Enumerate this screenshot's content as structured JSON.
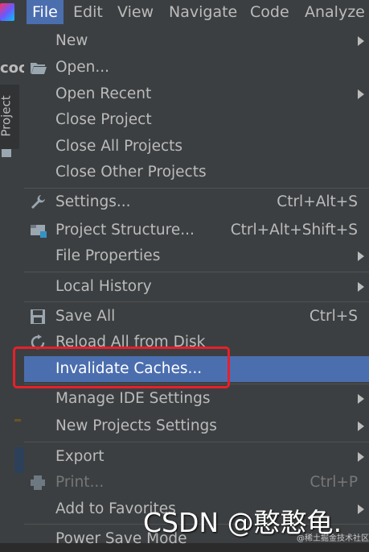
{
  "menubar": {
    "items": [
      {
        "label": "File",
        "active": true
      },
      {
        "label": "Edit"
      },
      {
        "label": "View"
      },
      {
        "label": "Navigate"
      },
      {
        "label": "Code"
      },
      {
        "label": "Analyze"
      }
    ]
  },
  "sidebar": {
    "tab_label": "Project",
    "toolbar_text": "coc"
  },
  "menu": {
    "items": [
      {
        "label": "New",
        "submenu": true
      },
      {
        "label": "Open...",
        "icon": "folder-open-icon"
      },
      {
        "label": "Open Recent",
        "submenu": true
      },
      {
        "label": "Close Project"
      },
      {
        "label": "Close All Projects"
      },
      {
        "label": "Close Other Projects"
      },
      {
        "label": "Settings...",
        "shortcut": "Ctrl+Alt+S",
        "icon": "wrench-icon"
      },
      {
        "label": "Project Structure...",
        "shortcut": "Ctrl+Alt+Shift+S",
        "icon": "project-structure-icon"
      },
      {
        "label": "File Properties",
        "submenu": true
      },
      {
        "label": "Local History",
        "submenu": true
      },
      {
        "label": "Save All",
        "shortcut": "Ctrl+S",
        "icon": "save-icon"
      },
      {
        "label": "Reload All from Disk",
        "icon": "reload-icon"
      },
      {
        "label": "Invalidate Caches...",
        "selected": true
      },
      {
        "label": "Manage IDE Settings",
        "submenu": true
      },
      {
        "label": "New Projects Settings",
        "submenu": true
      },
      {
        "label": "Export",
        "submenu": true
      },
      {
        "label": "Print...",
        "shortcut": "Ctrl+P",
        "icon": "print-icon",
        "disabled": true
      },
      {
        "label": "Add to Favorites",
        "submenu": true
      },
      {
        "label": "Power Save Mode"
      }
    ]
  },
  "watermark": {
    "main": "CSDN @憨憨龟.",
    "small": "@稀土掘金技术社区"
  },
  "colors": {
    "accent": "#4b6eaf",
    "menu_bg": "#3c3f41",
    "highlight_box": "#e8202a"
  }
}
